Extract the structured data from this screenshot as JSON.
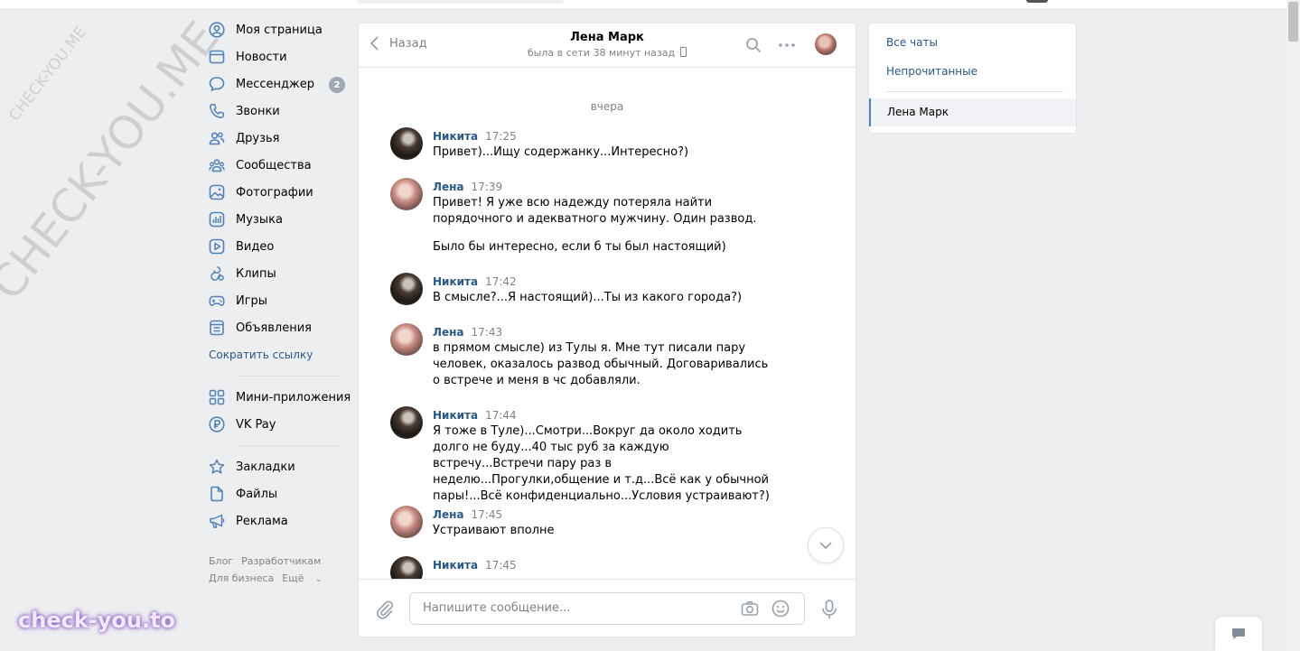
{
  "watermarks": {
    "diagonal_small": "CHECK-YOU.ME",
    "diagonal_large": "CHECK-YOU.ME",
    "brand": "check-you.to"
  },
  "nav": {
    "items": [
      {
        "label": "Моя страница",
        "icon": "user-circle-icon"
      },
      {
        "label": "Новости",
        "icon": "news-icon"
      },
      {
        "label": "Мессенджер",
        "icon": "chat-bubble-icon",
        "badge": "2"
      },
      {
        "label": "Звонки",
        "icon": "phone-icon"
      },
      {
        "label": "Друзья",
        "icon": "friends-icon"
      },
      {
        "label": "Сообщества",
        "icon": "groups-icon"
      },
      {
        "label": "Фотографии",
        "icon": "photo-icon"
      },
      {
        "label": "Музыка",
        "icon": "music-icon"
      },
      {
        "label": "Видео",
        "icon": "video-icon"
      },
      {
        "label": "Клипы",
        "icon": "clips-icon"
      },
      {
        "label": "Игры",
        "icon": "gamepad-icon"
      },
      {
        "label": "Объявления",
        "icon": "classifieds-icon"
      }
    ],
    "shorten_link": "Сократить ссылку",
    "items2": [
      {
        "label": "Мини-приложения",
        "icon": "grid-icon"
      },
      {
        "label": "VK Pay",
        "icon": "ruble-icon"
      }
    ],
    "items3": [
      {
        "label": "Закладки",
        "icon": "star-icon"
      },
      {
        "label": "Файлы",
        "icon": "file-icon"
      },
      {
        "label": "Реклама",
        "icon": "megaphone-icon"
      }
    ],
    "footer": {
      "blog": "Блог",
      "developers": "Разработчикам",
      "business": "Для бизнеса",
      "more": "Ещё"
    }
  },
  "chat": {
    "back_label": "Назад",
    "name": "Лена Марк",
    "status": "была в сети 38 минут назад",
    "day_separator": "вчера",
    "messages": [
      {
        "author": "Никита",
        "time": "17:25",
        "lines": [
          "Привет)...Ищу содержанку...Интересно?)"
        ]
      },
      {
        "author": "Лена",
        "time": "17:39",
        "lines": [
          "Привет! Я уже всю надежду потеряла найти порядочного и адекватного мужчину. Один развод.",
          "Было бы интересно, если б ты был настоящий)"
        ]
      },
      {
        "author": "Никита",
        "time": "17:42",
        "lines": [
          "В смысле?...Я настоящий)...Ты из какого города?)"
        ]
      },
      {
        "author": "Лена",
        "time": "17:43",
        "lines": [
          "в прямом смысле) из Тулы я. Мне тут писали пару человек, оказалось развод обычный. Договаривались о встрече и меня в чс добавляли."
        ]
      },
      {
        "author": "Никита",
        "time": "17:44",
        "lines": [
          "Я тоже в Туле)...Смотри...Вокруг да около ходить долго не буду...40 тыс руб за каждую встречу...Встречи пару раз в неделю...Прогулки,общение и т.д...Всё как у обычной пары!...Всё конфиденциально...Условия устраивают?)"
        ]
      },
      {
        "author": "Лена",
        "time": "17:45",
        "lines": [
          "Устраивают вполне"
        ]
      },
      {
        "author": "Никита",
        "time": "17:45",
        "lines": [
          ""
        ]
      }
    ],
    "input_placeholder": "Напишите сообщение..."
  },
  "filters": {
    "all": "Все чаты",
    "unread": "Непрочитанные",
    "active": "Лена Марк"
  },
  "colors": {
    "link": "#2a5885",
    "badge": "#a0a8b3",
    "icon": "#5181b8",
    "background": "#edeef0"
  }
}
